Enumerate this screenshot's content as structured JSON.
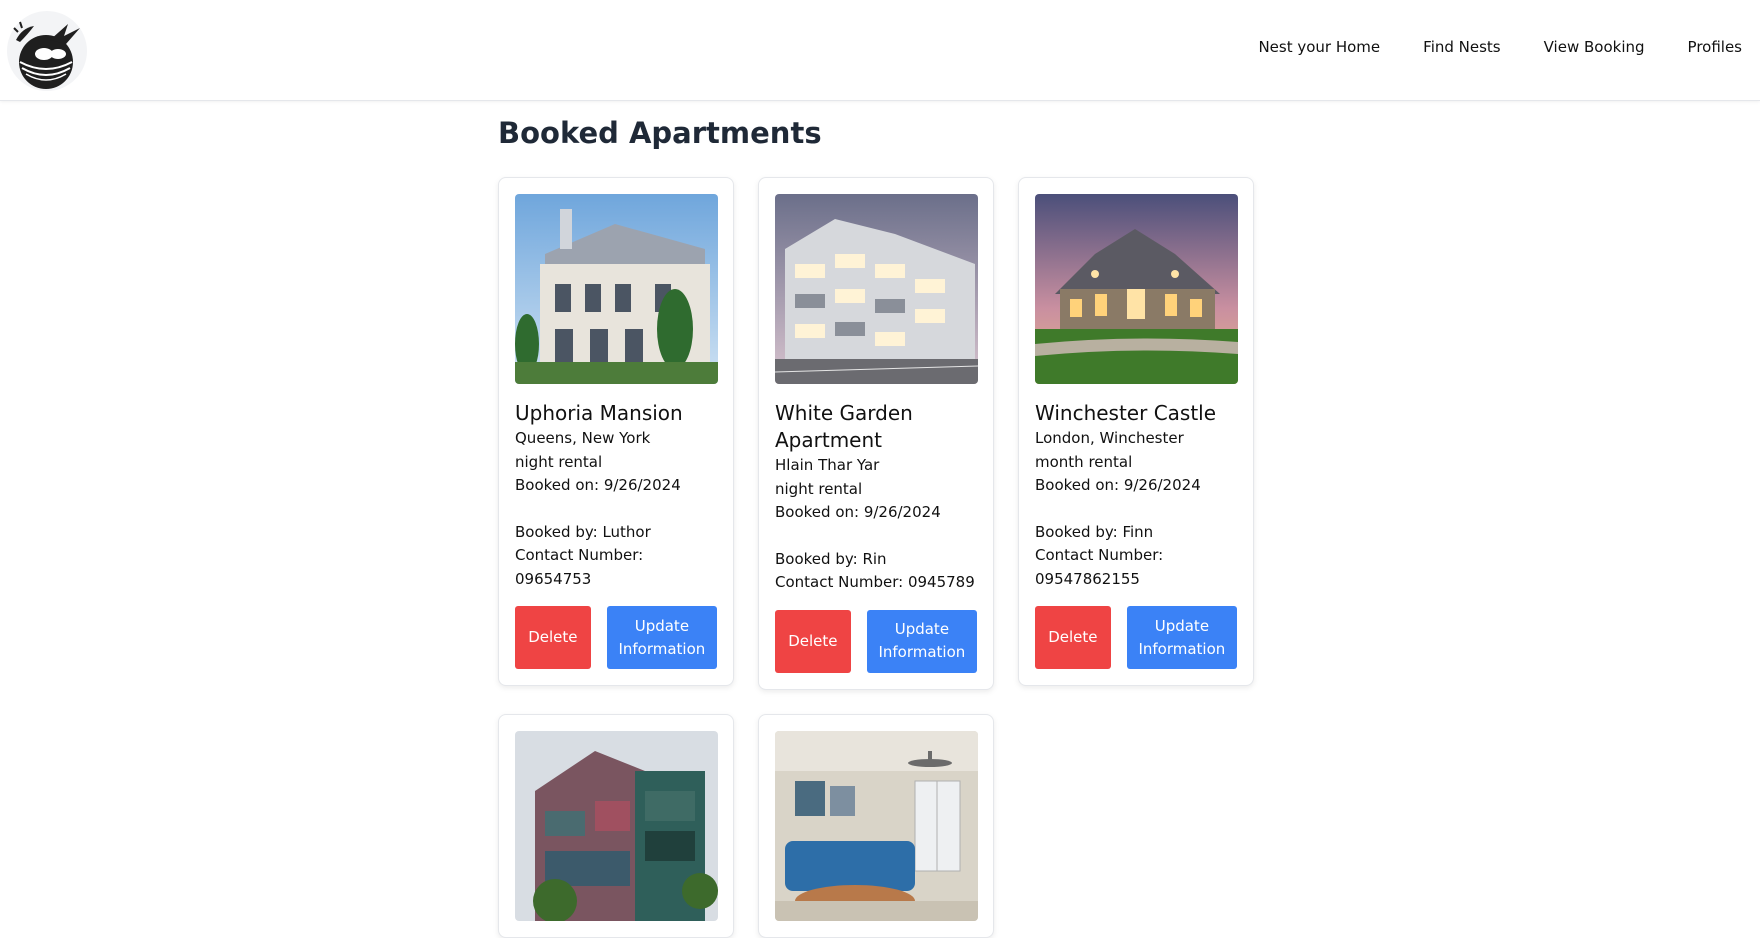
{
  "nav": {
    "links": [
      "Nest your Home",
      "Find Nests",
      "View Booking",
      "Profiles"
    ]
  },
  "page": {
    "title": "Booked Apartments"
  },
  "buttons": {
    "delete_label": "Delete",
    "update_label": "Update Information"
  },
  "bookings": [
    {
      "name": "Uphoria Mansion",
      "location": "Queens, New York",
      "rental_type": "night rental",
      "booked_on": "Booked on: 9/26/2024",
      "booked_by": "Booked by: Luthor",
      "contact": "Contact Number: 09654753"
    },
    {
      "name": "White Garden Apartment",
      "location": "Hlain Thar Yar",
      "rental_type": "night rental",
      "booked_on": "Booked on: 9/26/2024",
      "booked_by": "Booked by: Rin",
      "contact": "Contact Number: 0945789"
    },
    {
      "name": "Winchester Castle",
      "location": "London, Winchester",
      "rental_type": "month rental",
      "booked_on": "Booked on: 9/26/2024",
      "booked_by": "Booked by: Finn",
      "contact": "Contact Number: 09547862155"
    }
  ],
  "colors": {
    "delete": "#ef4444",
    "update": "#3b82f6",
    "title": "#1f2937"
  }
}
